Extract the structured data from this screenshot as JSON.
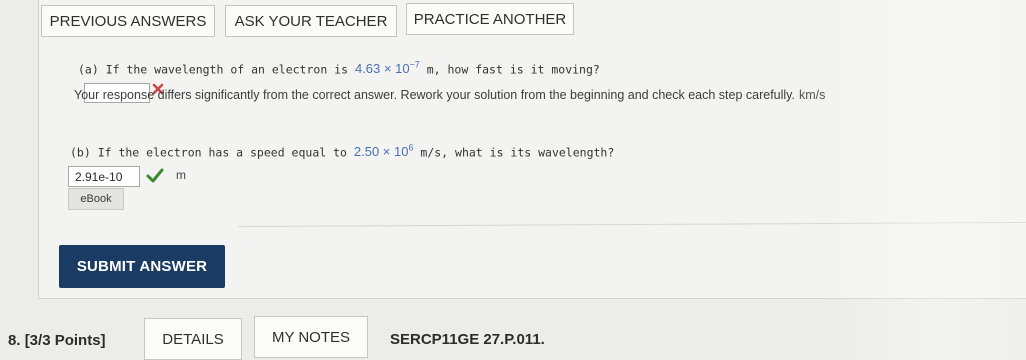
{
  "top_buttons": {
    "previous_answers": "PREVIOUS ANSWERS",
    "ask_teacher": "ASK YOUR TEACHER",
    "practice_another": "PRACTICE ANOTHER"
  },
  "part_a": {
    "prefix": "(a) If the wavelength of an electron is",
    "value_mantissa": "4.63 × 10",
    "value_exponent": "−7",
    "suffix": " m, how fast is it moving?",
    "answer_value": "",
    "status_icon": "x-mark-icon",
    "feedback": "Your response differs significantly from the correct answer. Rework your solution from the beginning and check each step carefully.",
    "unit": "km/s"
  },
  "part_b": {
    "prefix": "(b) If the electron has a speed equal to",
    "value_mantissa": "2.50 × 10",
    "value_exponent": "6",
    "suffix": " m/s, what is its wavelength?",
    "answer_value": "2.91e-10",
    "status_icon": "check-mark-icon",
    "unit": "m"
  },
  "ebook_label": "eBook",
  "submit_label": "SUBMIT ANSWER",
  "next_question": {
    "number": "8.",
    "points": "[3/3 Points]",
    "details_label": "DETAILS",
    "my_notes_label": "MY NOTES",
    "code": "SERCP11GE 27.P.011."
  },
  "colors": {
    "submit_bg": "#1a3c64",
    "error": "#c94848",
    "success": "#3a8a2e",
    "value_blue": "#4a6fb5"
  }
}
